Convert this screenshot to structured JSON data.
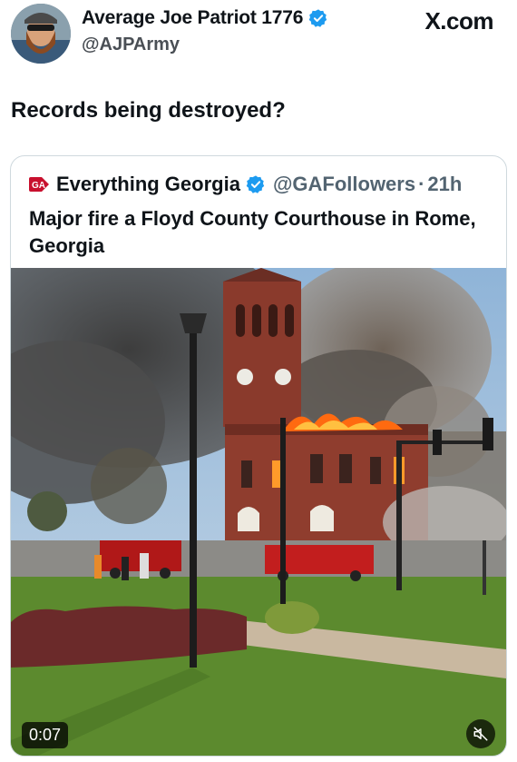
{
  "post": {
    "display_name": "Average Joe Patriot 1776",
    "handle": "@AJPArmy",
    "site": "X.com",
    "text": "Records being destroyed?",
    "avatar_icon": "bearded-man-avatar",
    "verified_color": "#1d9bf0"
  },
  "quoted": {
    "logo_icon": "ga-logo",
    "display_name": "Everything Georgia",
    "handle": "@GAFollowers",
    "separator": "·",
    "time": "21h",
    "text": "Major fire a Floyd County Courthouse in Rome, Georgia",
    "video": {
      "duration": "0:07",
      "mute_icon": "muted-speaker-icon"
    }
  }
}
